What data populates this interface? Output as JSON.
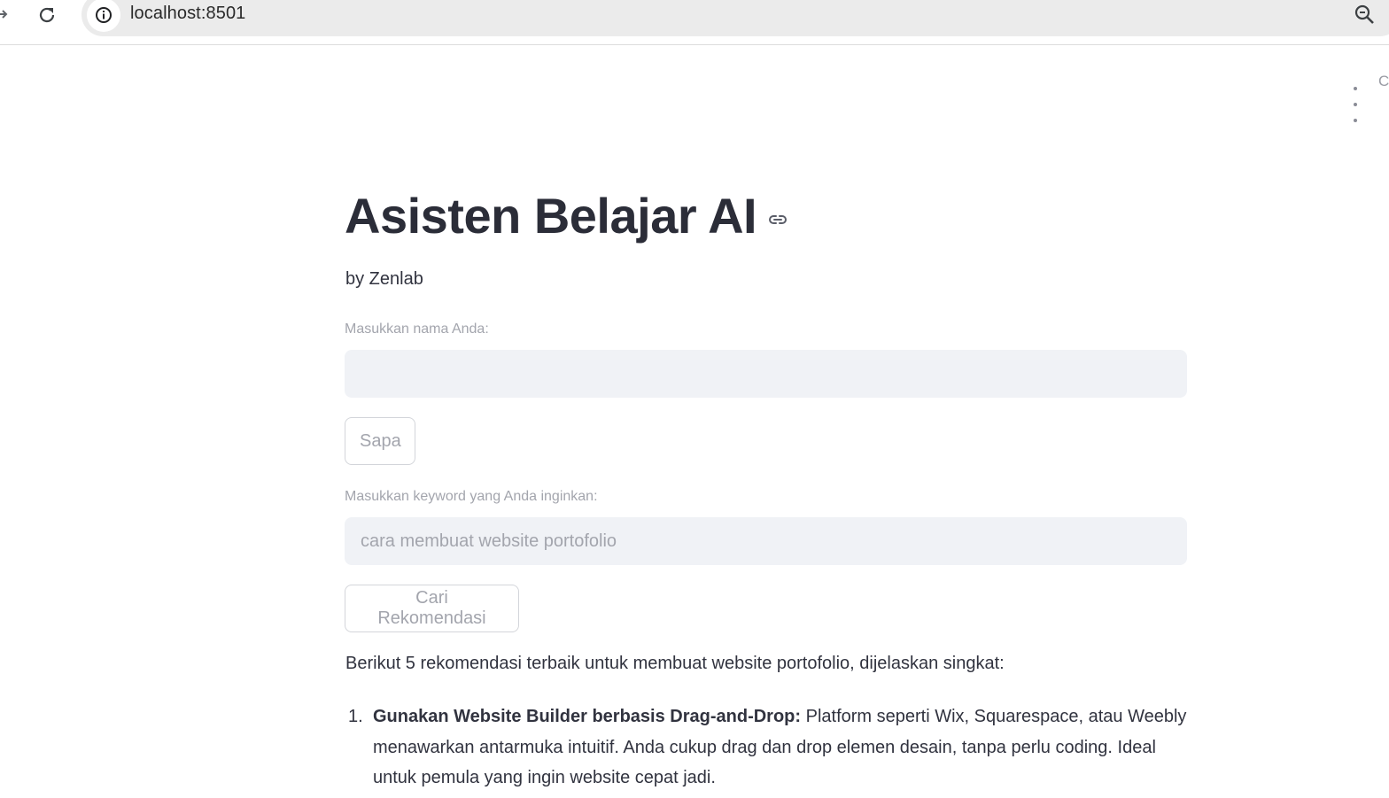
{
  "browser": {
    "url": "localhost:8501"
  },
  "app": {
    "title": "Asisten Belajar AI",
    "byline": "by Zenlab",
    "menu_partial_label": "C",
    "name_field": {
      "label": "Masukkan nama Anda:",
      "value": "",
      "placeholder": ""
    },
    "greet_button": "Sapa",
    "keyword_field": {
      "label": "Masukkan keyword yang Anda inginkan:",
      "value": "",
      "placeholder": "cara membuat website portofolio"
    },
    "search_button": "Cari Rekomendasi",
    "result_intro": "Berikut 5 rekomendasi terbaik untuk membuat website portofolio, dijelaskan singkat:",
    "recommendations": [
      {
        "number": "1.",
        "heading": "Gunakan Website Builder berbasis Drag-and-Drop:",
        "body": "Platform seperti Wix, Squarespace, atau Weebly menawarkan antarmuka intuitif. Anda cukup drag dan drop elemen desain, tanpa perlu coding. Ideal untuk pemula yang ingin website cepat jadi."
      }
    ]
  },
  "colors": {
    "text": "#31333f",
    "title": "#2b2d38",
    "muted": "#a3a5ad",
    "input_bg": "#f0f2f6",
    "button_border": "#d3d5da"
  },
  "icons": [
    "forward-arrow-icon",
    "reload-icon",
    "site-info-icon",
    "zoom-icon",
    "more-options-icon",
    "link-anchor-icon"
  ]
}
